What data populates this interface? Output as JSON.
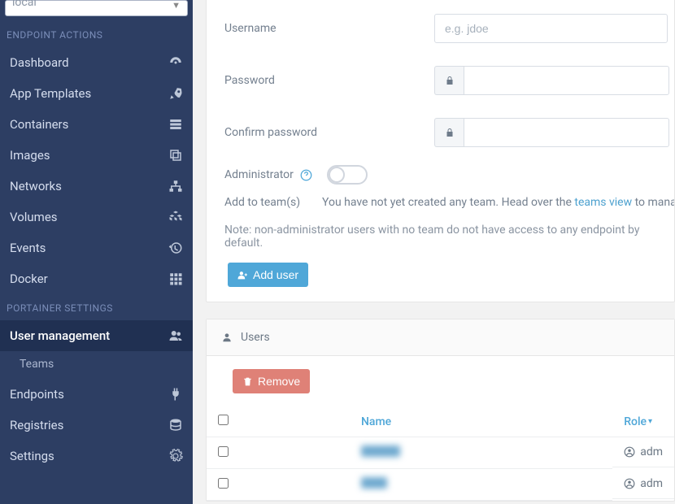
{
  "env_selector": {
    "value": "local"
  },
  "sidebar": {
    "section1": "ENDPOINT ACTIONS",
    "section2": "PORTAINER SETTINGS",
    "items1": [
      {
        "label": "Dashboard",
        "icon": "dashboard-icon"
      },
      {
        "label": "App Templates",
        "icon": "rocket-icon"
      },
      {
        "label": "Containers",
        "icon": "server-icon"
      },
      {
        "label": "Images",
        "icon": "clone-icon"
      },
      {
        "label": "Networks",
        "icon": "sitemap-icon"
      },
      {
        "label": "Volumes",
        "icon": "cubes-icon"
      },
      {
        "label": "Events",
        "icon": "history-icon"
      },
      {
        "label": "Docker",
        "icon": "grid-icon"
      }
    ],
    "items2": [
      {
        "label": "User management",
        "icon": "users-icon",
        "active": true,
        "sub": [
          "Teams"
        ]
      },
      {
        "label": "Endpoints",
        "icon": "plug-icon"
      },
      {
        "label": "Registries",
        "icon": "database-icon"
      },
      {
        "label": "Settings",
        "icon": "cogs-icon"
      }
    ]
  },
  "form": {
    "username_label": "Username",
    "username_placeholder": "e.g. jdoe",
    "password_label": "Password",
    "confirm_label": "Confirm password",
    "admin_label": "Administrator",
    "team_label": "Add to team(s)",
    "team_msg_pre": "You have not yet created any team. Head over the ",
    "team_link": "teams view",
    "team_msg_post": " to manage",
    "note": "Note: non-administrator users with no team do not have access to any endpoint by default.",
    "add_button": "Add user"
  },
  "users_panel": {
    "title": "Users",
    "remove_button": "Remove",
    "col_name": "Name",
    "col_role": "Role",
    "rows": [
      {
        "role": "adm"
      },
      {
        "role": "adm"
      }
    ]
  }
}
